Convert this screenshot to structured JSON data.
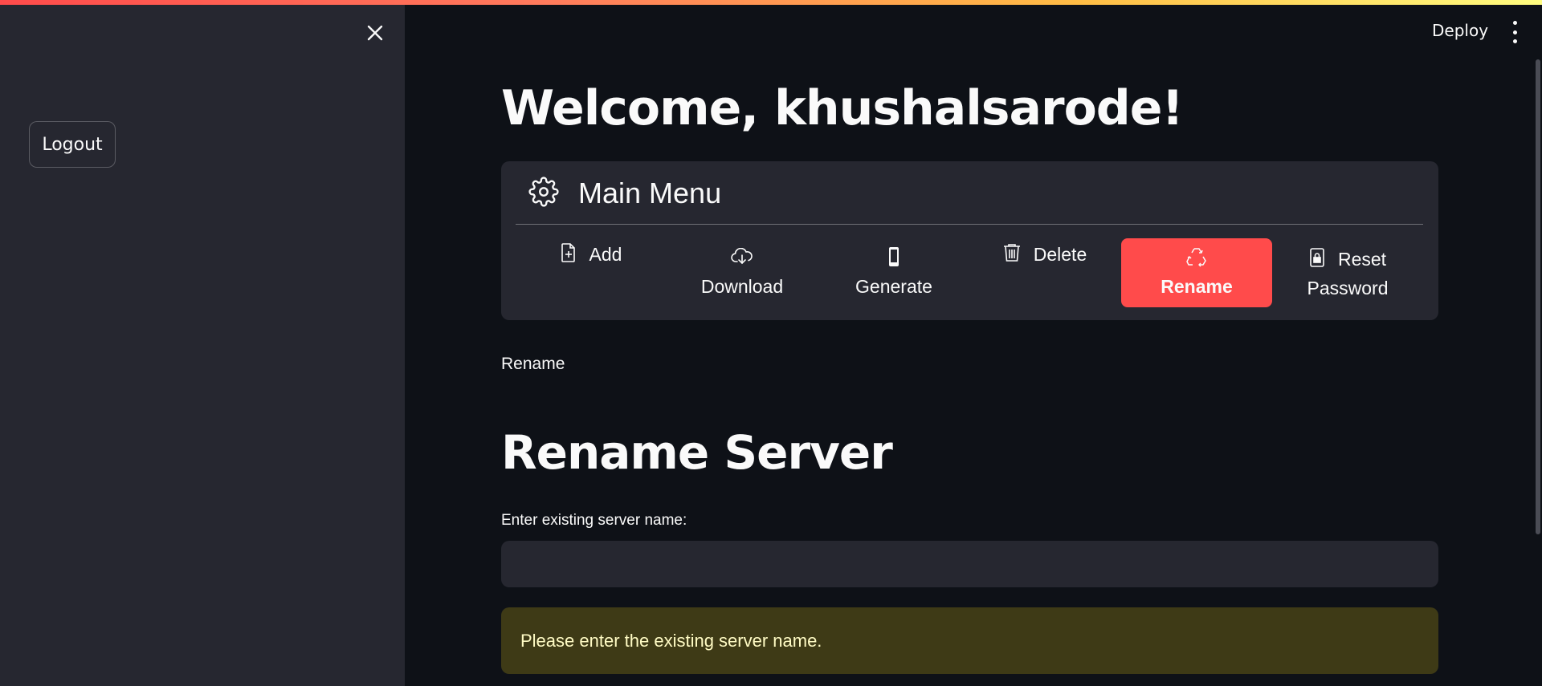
{
  "header": {
    "deploy_label": "Deploy",
    "more_icon": "more-vertical-icon"
  },
  "sidebar": {
    "close_icon": "close-icon",
    "logout_label": "Logout"
  },
  "main": {
    "welcome": "Welcome, khushalsarode!",
    "menu": {
      "title": "Main Menu",
      "title_icon": "gear-icon",
      "items": [
        {
          "label": "Add",
          "icon": "file-plus-icon"
        },
        {
          "label": "Download",
          "icon": "cloud-download-icon"
        },
        {
          "label": "Generate",
          "icon": "phone-icon"
        },
        {
          "label": "Delete",
          "icon": "trash-icon"
        },
        {
          "label": "Rename",
          "icon": "recycle-icon",
          "active": true
        },
        {
          "label": "Reset Password",
          "label_line1": "Reset",
          "label_line2": "Password",
          "icon": "lock-icon"
        }
      ],
      "active_color": "#ff4b4b"
    },
    "section_label": "Rename",
    "heading": "Rename Server",
    "field_label": "Enter existing server name:",
    "field_value": "",
    "field_placeholder": "",
    "warning_text": "Please enter the existing server name.",
    "warning_bg": "#3e3a16"
  }
}
